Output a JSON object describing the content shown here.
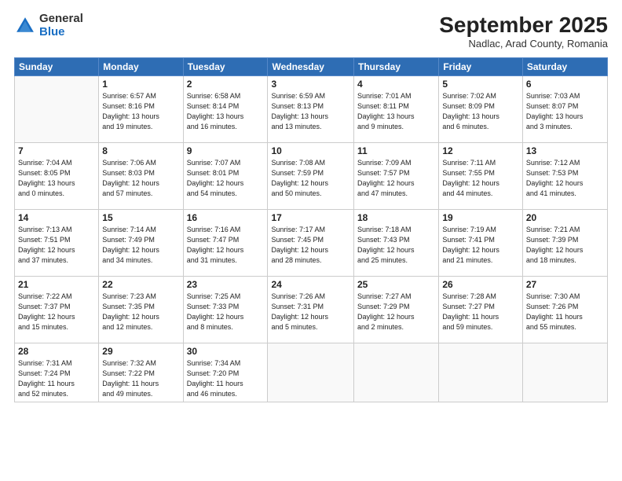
{
  "header": {
    "logo_general": "General",
    "logo_blue": "Blue",
    "month_title": "September 2025",
    "location": "Nadlac, Arad County, Romania"
  },
  "days_of_week": [
    "Sunday",
    "Monday",
    "Tuesday",
    "Wednesday",
    "Thursday",
    "Friday",
    "Saturday"
  ],
  "weeks": [
    [
      {
        "day": "",
        "info": ""
      },
      {
        "day": "1",
        "info": "Sunrise: 6:57 AM\nSunset: 8:16 PM\nDaylight: 13 hours\nand 19 minutes."
      },
      {
        "day": "2",
        "info": "Sunrise: 6:58 AM\nSunset: 8:14 PM\nDaylight: 13 hours\nand 16 minutes."
      },
      {
        "day": "3",
        "info": "Sunrise: 6:59 AM\nSunset: 8:13 PM\nDaylight: 13 hours\nand 13 minutes."
      },
      {
        "day": "4",
        "info": "Sunrise: 7:01 AM\nSunset: 8:11 PM\nDaylight: 13 hours\nand 9 minutes."
      },
      {
        "day": "5",
        "info": "Sunrise: 7:02 AM\nSunset: 8:09 PM\nDaylight: 13 hours\nand 6 minutes."
      },
      {
        "day": "6",
        "info": "Sunrise: 7:03 AM\nSunset: 8:07 PM\nDaylight: 13 hours\nand 3 minutes."
      }
    ],
    [
      {
        "day": "7",
        "info": "Sunrise: 7:04 AM\nSunset: 8:05 PM\nDaylight: 13 hours\nand 0 minutes."
      },
      {
        "day": "8",
        "info": "Sunrise: 7:06 AM\nSunset: 8:03 PM\nDaylight: 12 hours\nand 57 minutes."
      },
      {
        "day": "9",
        "info": "Sunrise: 7:07 AM\nSunset: 8:01 PM\nDaylight: 12 hours\nand 54 minutes."
      },
      {
        "day": "10",
        "info": "Sunrise: 7:08 AM\nSunset: 7:59 PM\nDaylight: 12 hours\nand 50 minutes."
      },
      {
        "day": "11",
        "info": "Sunrise: 7:09 AM\nSunset: 7:57 PM\nDaylight: 12 hours\nand 47 minutes."
      },
      {
        "day": "12",
        "info": "Sunrise: 7:11 AM\nSunset: 7:55 PM\nDaylight: 12 hours\nand 44 minutes."
      },
      {
        "day": "13",
        "info": "Sunrise: 7:12 AM\nSunset: 7:53 PM\nDaylight: 12 hours\nand 41 minutes."
      }
    ],
    [
      {
        "day": "14",
        "info": "Sunrise: 7:13 AM\nSunset: 7:51 PM\nDaylight: 12 hours\nand 37 minutes."
      },
      {
        "day": "15",
        "info": "Sunrise: 7:14 AM\nSunset: 7:49 PM\nDaylight: 12 hours\nand 34 minutes."
      },
      {
        "day": "16",
        "info": "Sunrise: 7:16 AM\nSunset: 7:47 PM\nDaylight: 12 hours\nand 31 minutes."
      },
      {
        "day": "17",
        "info": "Sunrise: 7:17 AM\nSunset: 7:45 PM\nDaylight: 12 hours\nand 28 minutes."
      },
      {
        "day": "18",
        "info": "Sunrise: 7:18 AM\nSunset: 7:43 PM\nDaylight: 12 hours\nand 25 minutes."
      },
      {
        "day": "19",
        "info": "Sunrise: 7:19 AM\nSunset: 7:41 PM\nDaylight: 12 hours\nand 21 minutes."
      },
      {
        "day": "20",
        "info": "Sunrise: 7:21 AM\nSunset: 7:39 PM\nDaylight: 12 hours\nand 18 minutes."
      }
    ],
    [
      {
        "day": "21",
        "info": "Sunrise: 7:22 AM\nSunset: 7:37 PM\nDaylight: 12 hours\nand 15 minutes."
      },
      {
        "day": "22",
        "info": "Sunrise: 7:23 AM\nSunset: 7:35 PM\nDaylight: 12 hours\nand 12 minutes."
      },
      {
        "day": "23",
        "info": "Sunrise: 7:25 AM\nSunset: 7:33 PM\nDaylight: 12 hours\nand 8 minutes."
      },
      {
        "day": "24",
        "info": "Sunrise: 7:26 AM\nSunset: 7:31 PM\nDaylight: 12 hours\nand 5 minutes."
      },
      {
        "day": "25",
        "info": "Sunrise: 7:27 AM\nSunset: 7:29 PM\nDaylight: 12 hours\nand 2 minutes."
      },
      {
        "day": "26",
        "info": "Sunrise: 7:28 AM\nSunset: 7:27 PM\nDaylight: 11 hours\nand 59 minutes."
      },
      {
        "day": "27",
        "info": "Sunrise: 7:30 AM\nSunset: 7:26 PM\nDaylight: 11 hours\nand 55 minutes."
      }
    ],
    [
      {
        "day": "28",
        "info": "Sunrise: 7:31 AM\nSunset: 7:24 PM\nDaylight: 11 hours\nand 52 minutes."
      },
      {
        "day": "29",
        "info": "Sunrise: 7:32 AM\nSunset: 7:22 PM\nDaylight: 11 hours\nand 49 minutes."
      },
      {
        "day": "30",
        "info": "Sunrise: 7:34 AM\nSunset: 7:20 PM\nDaylight: 11 hours\nand 46 minutes."
      },
      {
        "day": "",
        "info": ""
      },
      {
        "day": "",
        "info": ""
      },
      {
        "day": "",
        "info": ""
      },
      {
        "day": "",
        "info": ""
      }
    ]
  ]
}
